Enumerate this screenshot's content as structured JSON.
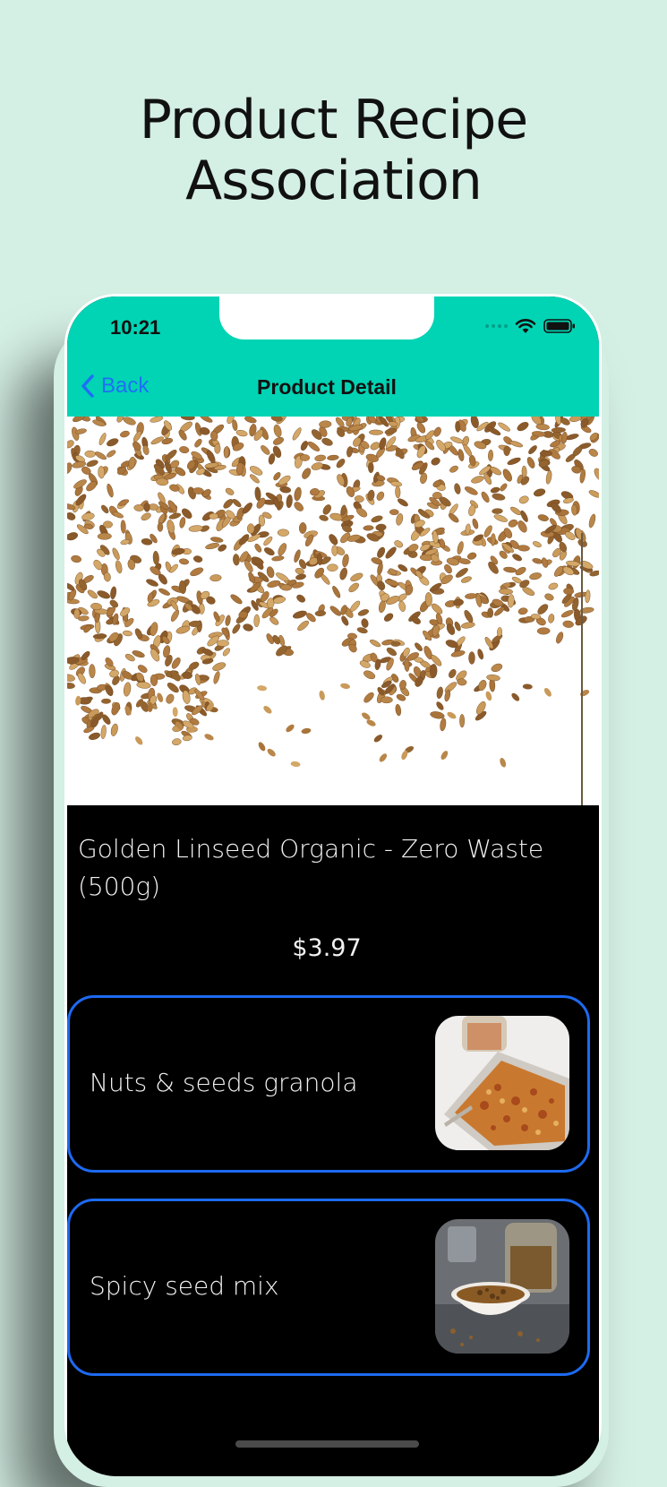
{
  "headline": {
    "line1": "Product Recipe",
    "line2": "Association"
  },
  "status_bar": {
    "time": "10:21",
    "icons": [
      "signal-dots-icon",
      "wifi-icon",
      "battery-icon"
    ]
  },
  "nav": {
    "back_label": "Back",
    "title": "Product Detail",
    "back_icon": "chevron-left-icon"
  },
  "product": {
    "name": "Golden Linseed Organic - Zero Waste (500g)",
    "price": "$3.97",
    "image": "golden-linseed-photo"
  },
  "recipes": [
    {
      "title": "Nuts & seeds granola",
      "image": "granola-tray-photo"
    },
    {
      "title": "Spicy seed mix",
      "image": "seed-mix-bowl-photo"
    }
  ],
  "colors": {
    "page_background": "#d4efe4",
    "nav_bar": "#00d4b4",
    "accent_blue": "#1d6af0",
    "screen_background": "#000000"
  }
}
